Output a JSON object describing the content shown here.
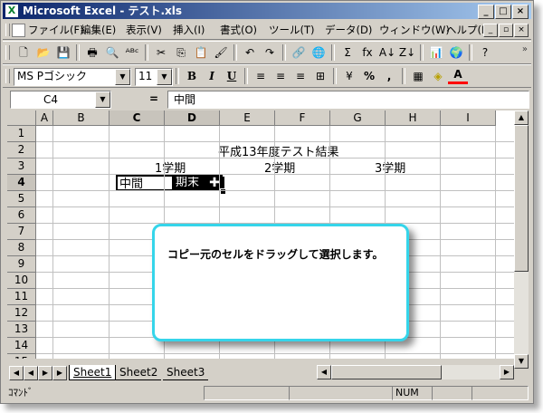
{
  "window": {
    "app_icon": "X",
    "title": "Microsoft Excel - テスト.xls",
    "minimize": "_",
    "maximize": "□",
    "close": "×"
  },
  "menu": {
    "items": [
      "ファイル(F)",
      "編集(E)",
      "表示(V)",
      "挿入(I)",
      "書式(O)",
      "ツール(T)",
      "データ(D)",
      "ウィンドウ(W)",
      "ヘルプ(H)"
    ],
    "doc_minimize": "_",
    "doc_restore": "▫",
    "doc_close": "×"
  },
  "toolbar1": {
    "icons": [
      "new-icon",
      "open-icon",
      "save-icon",
      "print-icon",
      "print-preview-icon",
      "spelling-icon",
      "cut-icon",
      "copy-icon",
      "paste-icon",
      "format-painter-icon",
      "undo-icon",
      "redo-icon",
      "hyperlink-icon",
      "web-icon",
      "autosum-icon",
      "function-icon",
      "sort-asc-icon",
      "sort-desc-icon",
      "chart-wizard-icon",
      "map-icon",
      "assistant-icon"
    ],
    "glyphs": [
      "🗋",
      "📂",
      "💾",
      "🖶",
      "🔍",
      "ᴬᴮᶜ",
      "✂",
      "⎘",
      "📋",
      "🖌",
      "↶",
      "↷",
      "🔗",
      "🌐",
      "Σ",
      "fx",
      "A↓",
      "Z↓",
      "📊",
      "🌍",
      "?"
    ]
  },
  "toolbar2": {
    "font_name": "MS Pゴシック",
    "font_size": "11",
    "bold": "B",
    "italic": "I",
    "underline": "U",
    "percent": "%",
    "comma": ",",
    "align_glyphs": [
      "≡",
      "≡",
      "≡",
      "⊞"
    ],
    "currency_glyph": "¥",
    "borders_glyph": "▦",
    "fill_glyph": "◈",
    "font_color_glyph": "A",
    "chevron": "»"
  },
  "formula_bar": {
    "name_box": "C4",
    "equals": "=",
    "content": "中間"
  },
  "grid": {
    "columns": [
      "A",
      "B",
      "C",
      "D",
      "E",
      "F",
      "G",
      "H",
      "I"
    ],
    "rows": [
      "1",
      "2",
      "3",
      "4",
      "5",
      "6",
      "7",
      "8",
      "9",
      "10",
      "11",
      "12",
      "13",
      "14",
      "15"
    ],
    "selected_columns": [
      "C",
      "D"
    ],
    "selected_row": "4",
    "title_cell": "平成13年度テスト結果",
    "term1": "1学期",
    "term2": "2学期",
    "term3": "3学期",
    "c4": "中間",
    "d4": "期末"
  },
  "callout": {
    "message": "コピー元のセルをドラッグして選択します。",
    "border_color": "#35d5ea"
  },
  "sheets": {
    "tabs": [
      "Sheet1",
      "Sheet2",
      "Sheet3"
    ],
    "active": "Sheet1"
  },
  "status": {
    "mode": "ｺﾏﾝﾄﾞ",
    "num": "NUM"
  }
}
